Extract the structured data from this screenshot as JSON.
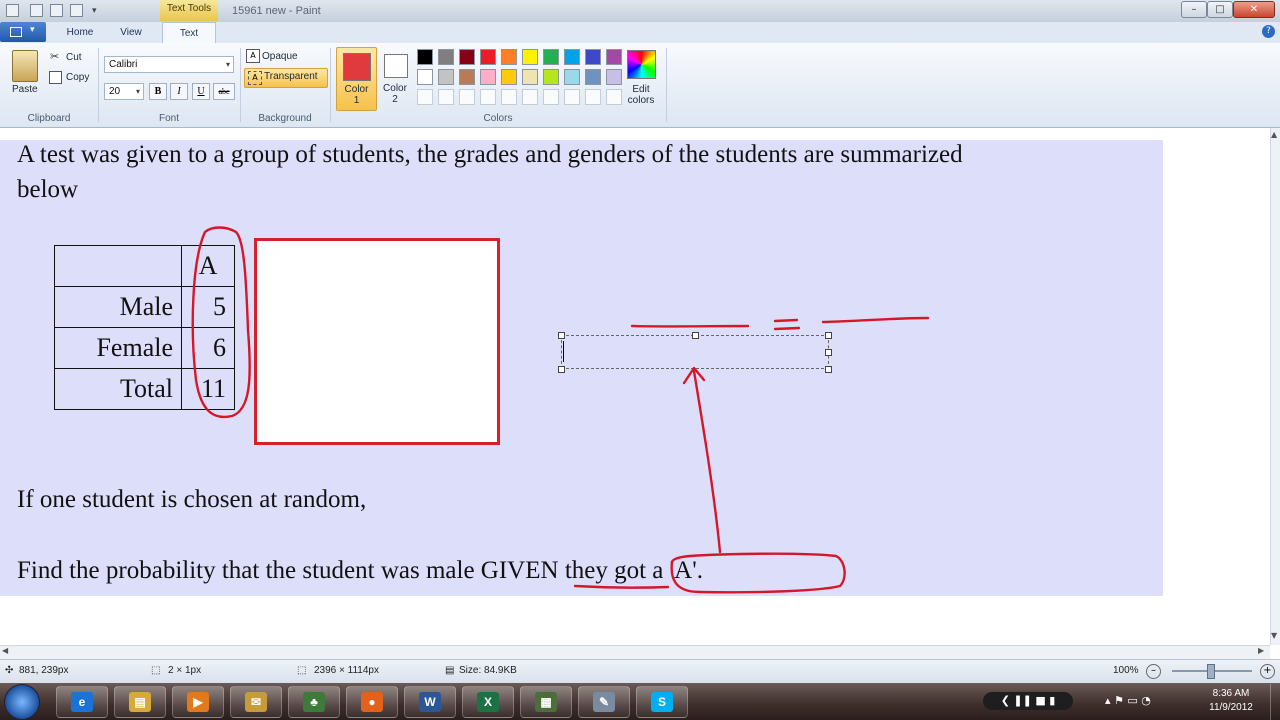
{
  "window": {
    "context_tab": "Text Tools",
    "title": "15961 new - Paint",
    "minimize": "–",
    "maximize": "□",
    "close": "✕",
    "help": "?"
  },
  "tabs": [
    {
      "label": "Home"
    },
    {
      "label": "View"
    },
    {
      "label": "Text"
    }
  ],
  "clipboard": {
    "paste": "Paste",
    "cut": "Cut",
    "copy": "Copy",
    "group": "Clipboard"
  },
  "font": {
    "family": "Calibri",
    "size": "20",
    "bold": "B",
    "italic": "I",
    "underline": "U",
    "strike": "abc",
    "group": "Font"
  },
  "background": {
    "opaque": "Opaque",
    "transparent": "Transparent",
    "group": "Background"
  },
  "colors": {
    "color1_line1": "Color",
    "color1_line2": "1",
    "color2_line1": "Color",
    "color2_line2": "2",
    "edit_line1": "Edit",
    "edit_line2": "colors",
    "group": "Colors",
    "color1_value": "#e03a3e",
    "color2_value": "#ffffff",
    "palette_row1": [
      "#000000",
      "#7f7f7f",
      "#880015",
      "#ed1c24",
      "#ff7f27",
      "#fff200",
      "#22b14c",
      "#00a2e8",
      "#3f48cc",
      "#a349a4"
    ],
    "palette_row2": [
      "#ffffff",
      "#c3c3c3",
      "#b97a57",
      "#ffaec9",
      "#ffc90e",
      "#efe4b0",
      "#b5e61d",
      "#99d9ea",
      "#7092be",
      "#c8bfe7"
    ]
  },
  "document": {
    "intro_line1": "A test was given to a group of students, the grades and genders of the students are summarized",
    "intro_line2": "below",
    "question1": "If one student is chosen at random,",
    "question2": "Find the probability that the student was male GIVEN they got a 'A'.",
    "table": {
      "header": [
        "",
        "A"
      ],
      "rows": [
        [
          "Male",
          "5"
        ],
        [
          "Female",
          "6"
        ],
        [
          "Total",
          "11"
        ]
      ]
    }
  },
  "status": {
    "cursor": "881, 239px",
    "selection": "2 × 1px",
    "image_size": "2396 × 1114px",
    "file_size": "Size: 84.9KB",
    "zoom": "100%"
  },
  "taskbar": {
    "time": "8:36 AM",
    "date": "11/9/2012",
    "apps": [
      "Internet Explorer",
      "File Explorer",
      "Media Player",
      "Messenger",
      "Game",
      "Firefox",
      "Word",
      "Excel",
      "Calculator",
      "Paint",
      "Skype"
    ]
  }
}
